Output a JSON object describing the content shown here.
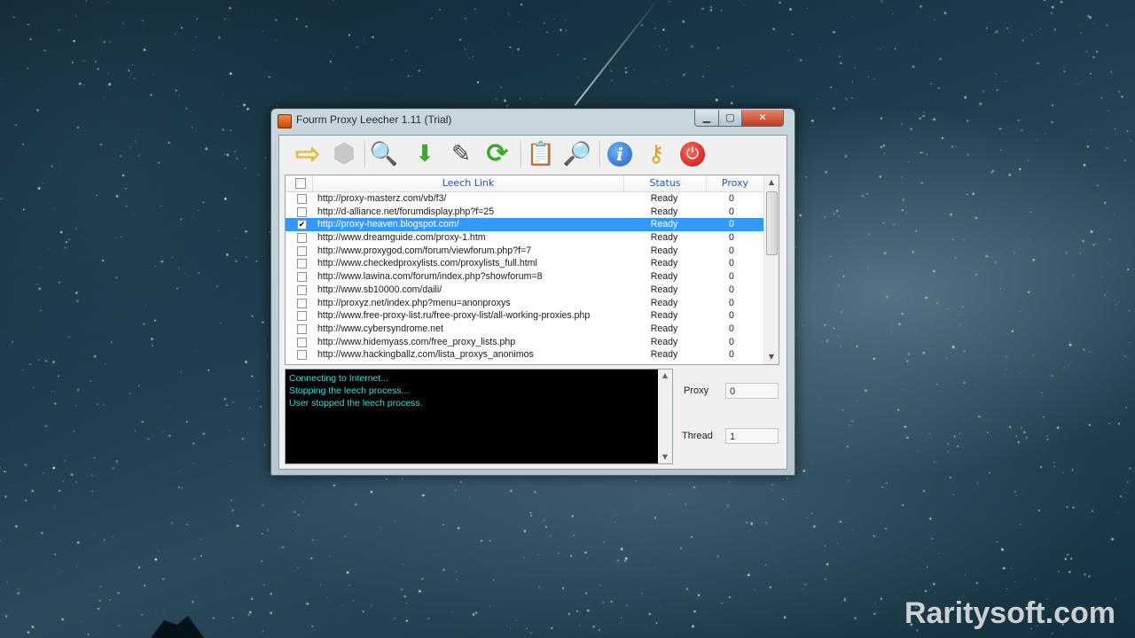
{
  "window": {
    "title": "Fourm Proxy Leecher 1.11 (Trial)"
  },
  "toolbar": {
    "buttons": [
      {
        "name": "start",
        "glyph": "⇨",
        "color": "#f0c419"
      },
      {
        "name": "stop",
        "glyph": "⬢",
        "color": "#c8c8c8"
      },
      {
        "name": "search-settings",
        "glyph": "🔍",
        "color": "#6a6ac8"
      },
      {
        "name": "download",
        "glyph": "⬇",
        "color": "#3ea82e"
      },
      {
        "name": "edit",
        "glyph": "✎",
        "color": "#444444"
      },
      {
        "name": "refresh",
        "glyph": "⟳",
        "color": "#3ea82e"
      },
      {
        "name": "clipboard",
        "glyph": "📋",
        "color": "#c9a35c"
      },
      {
        "name": "find",
        "glyph": "🔎",
        "color": "#4a7ab8"
      },
      {
        "name": "info",
        "glyph": "i",
        "color": "#1e6fd1"
      },
      {
        "name": "key",
        "glyph": "⚷",
        "color": "#e0a020"
      },
      {
        "name": "power",
        "glyph": "⏻",
        "color": "#e02020"
      }
    ]
  },
  "list": {
    "headers": {
      "link": "Leech Link",
      "status": "Status",
      "proxy": "Proxy"
    },
    "rows": [
      {
        "link": "http://proxy-masterz.com/vb/f3/",
        "status": "Ready",
        "proxy": "0",
        "checked": false,
        "selected": false
      },
      {
        "link": "http://d-alliance.net/forumdisplay.php?f=25",
        "status": "Ready",
        "proxy": "0",
        "checked": false,
        "selected": false
      },
      {
        "link": "http://proxy-heaven.blogspot.com/",
        "status": "Ready",
        "proxy": "0",
        "checked": true,
        "selected": true
      },
      {
        "link": "http://www.dreamguide.com/proxy-1.htm",
        "status": "Ready",
        "proxy": "0",
        "checked": false,
        "selected": false
      },
      {
        "link": "http://www.proxygod.com/forum/viewforum.php?f=7",
        "status": "Ready",
        "proxy": "0",
        "checked": false,
        "selected": false
      },
      {
        "link": "http://www.checkedproxylists.com/proxylists_full.html",
        "status": "Ready",
        "proxy": "0",
        "checked": false,
        "selected": false
      },
      {
        "link": "http://www.lawina.com/forum/index.php?showforum=8",
        "status": "Ready",
        "proxy": "0",
        "checked": false,
        "selected": false
      },
      {
        "link": "http://www.sb10000.com/daili/",
        "status": "Ready",
        "proxy": "0",
        "checked": false,
        "selected": false
      },
      {
        "link": "http://proxyz.net/index.php?menu=anonproxys",
        "status": "Ready",
        "proxy": "0",
        "checked": false,
        "selected": false
      },
      {
        "link": "http://www.free-proxy-list.ru/free-proxy-list/all-working-proxies.php",
        "status": "Ready",
        "proxy": "0",
        "checked": false,
        "selected": false
      },
      {
        "link": "http://www.cybersyndrome.net",
        "status": "Ready",
        "proxy": "0",
        "checked": false,
        "selected": false
      },
      {
        "link": "http://www.hidemyass.com/free_proxy_lists.php",
        "status": "Ready",
        "proxy": "0",
        "checked": false,
        "selected": false
      },
      {
        "link": "http://www.hackingballz.com/lista_proxys_anonimos",
        "status": "Ready",
        "proxy": "0",
        "checked": false,
        "selected": false
      }
    ]
  },
  "log": {
    "lines": [
      "Connecting to Internet...",
      "Stopping the leech process...",
      "User stopped the leech process."
    ]
  },
  "side": {
    "proxy_label": "Proxy",
    "proxy_value": "0",
    "thread_label": "Thread",
    "thread_value": "1"
  },
  "watermark": "Raritysoft.com"
}
